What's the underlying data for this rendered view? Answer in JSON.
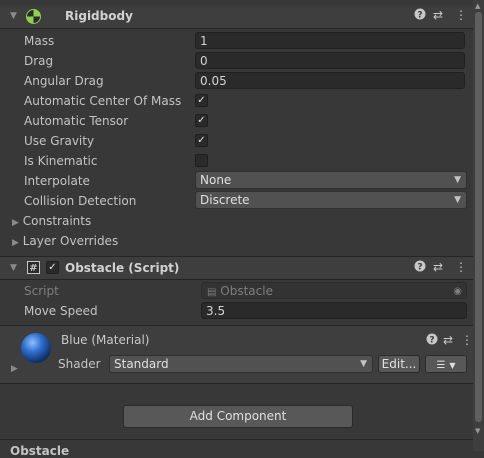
{
  "rigidbody": {
    "title": "Rigidbody",
    "fields": {
      "mass": {
        "label": "Mass",
        "value": "1"
      },
      "drag": {
        "label": "Drag",
        "value": "0"
      },
      "angular_drag": {
        "label": "Angular Drag",
        "value": "0.05"
      },
      "auto_center": {
        "label": "Automatic Center Of Mass",
        "checked": true
      },
      "auto_tensor": {
        "label": "Automatic Tensor",
        "checked": true
      },
      "use_gravity": {
        "label": "Use Gravity",
        "checked": true
      },
      "is_kinematic": {
        "label": "Is Kinematic",
        "checked": false
      },
      "interpolate": {
        "label": "Interpolate",
        "value": "None"
      },
      "collision_detection": {
        "label": "Collision Detection",
        "value": "Discrete"
      }
    },
    "foldouts": {
      "constraints": "Constraints",
      "layer_overrides": "Layer Overrides"
    }
  },
  "obstacle_script": {
    "title": "Obstacle (Script)",
    "script": {
      "label": "Script",
      "value": "Obstacle"
    },
    "move_speed": {
      "label": "Move Speed",
      "value": "3.5"
    }
  },
  "material": {
    "title": "Blue (Material)",
    "shader_label": "Shader",
    "shader_value": "Standard",
    "edit_label": "Edit...",
    "sphere_color": "#2e6fd0"
  },
  "add_component_label": "Add Component",
  "bottom_label": "Obstacle",
  "colors": {
    "panel": "#383838",
    "header": "#3e3e3e",
    "field": "#2a2a2a",
    "accent": "#2e6fd0"
  }
}
